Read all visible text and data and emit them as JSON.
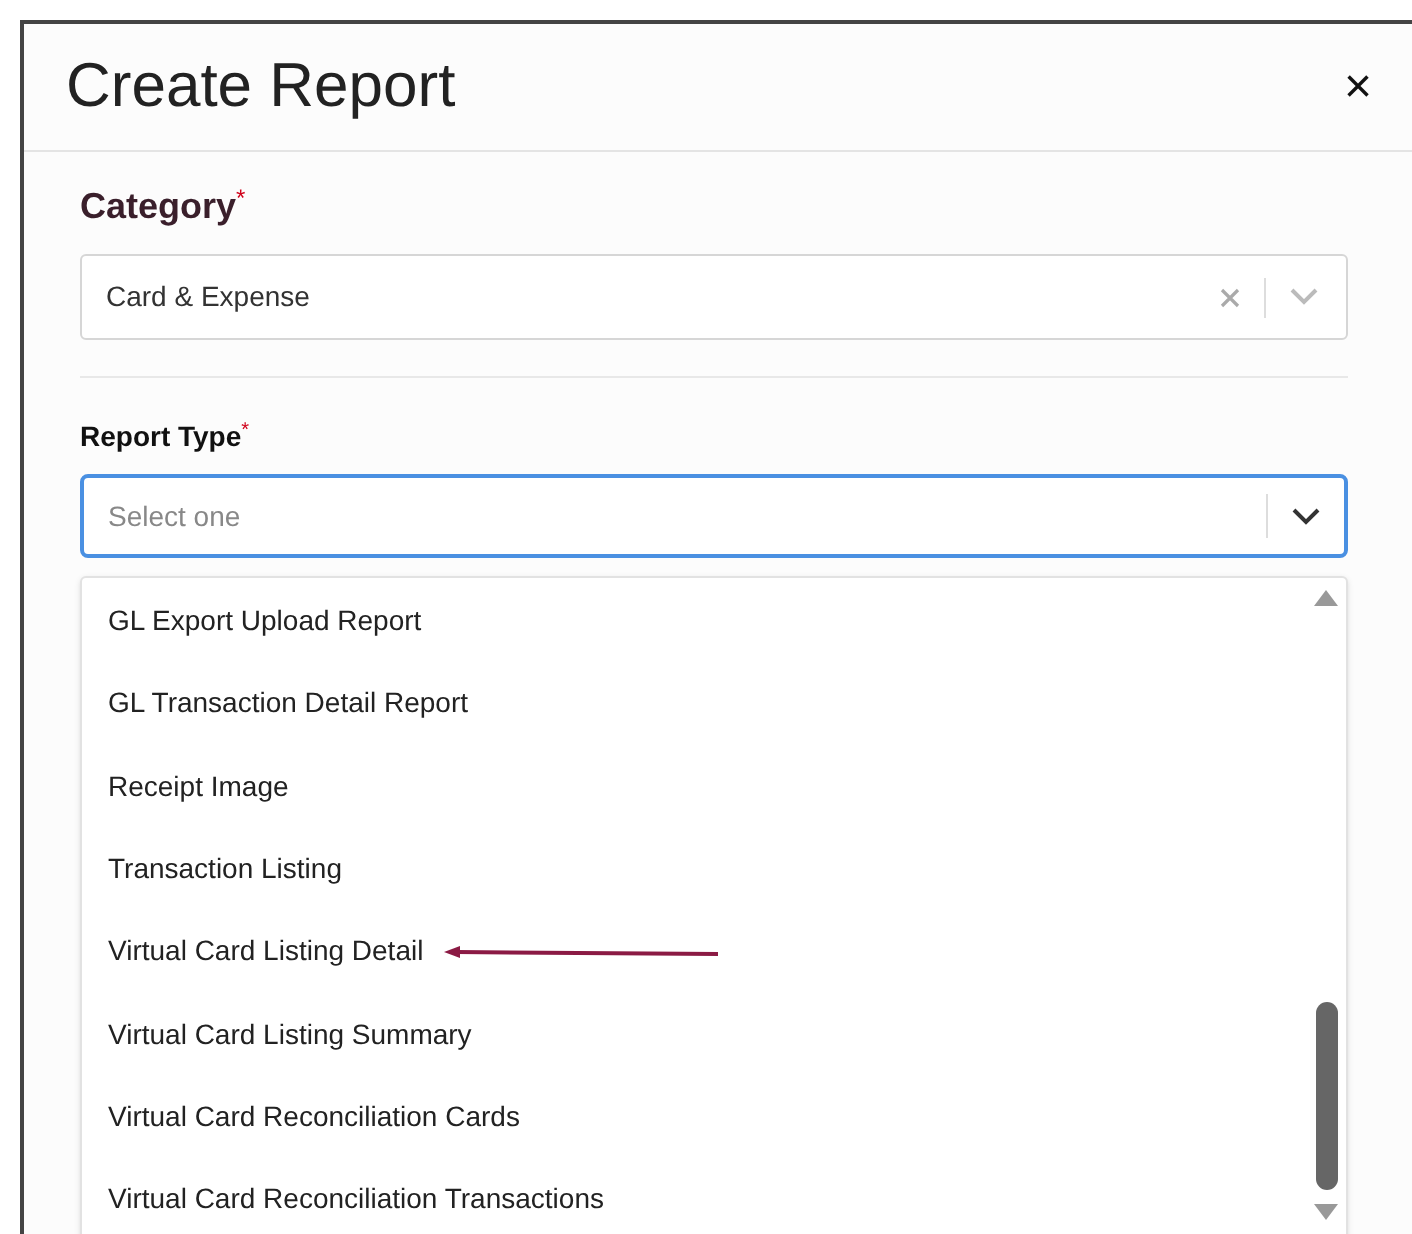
{
  "dialog": {
    "title": "Create Report",
    "close": "×"
  },
  "category": {
    "label": "Category",
    "required": "*",
    "value": "Card & Expense"
  },
  "report_type": {
    "label": "Report Type",
    "required": "*",
    "placeholder": "Select one",
    "focused": true
  },
  "options": [
    {
      "label": "GL Export Upload Report"
    },
    {
      "label": "GL Transaction Detail Report"
    },
    {
      "label": "Receipt Image"
    },
    {
      "label": "Transaction Listing"
    },
    {
      "label": "Virtual Card Listing Detail",
      "annotated": true
    },
    {
      "label": "Virtual Card Listing Summary"
    },
    {
      "label": "Virtual Card Reconciliation Cards"
    },
    {
      "label": "Virtual Card Reconciliation Transactions"
    }
  ]
}
